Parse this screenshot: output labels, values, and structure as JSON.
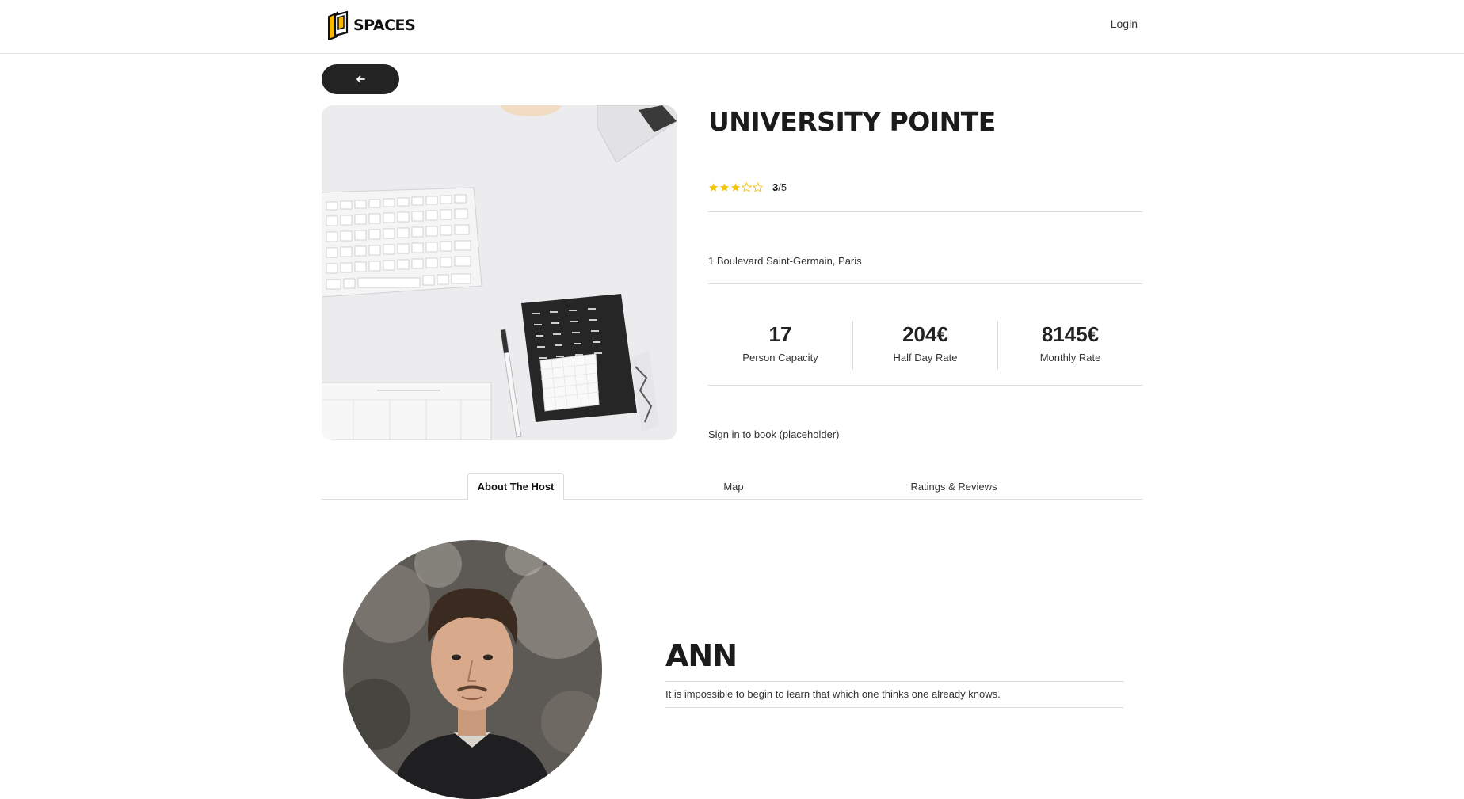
{
  "header": {
    "logo_text": "SPACES",
    "login_label": "Login"
  },
  "back_button": {
    "icon": "arrow-left-icon"
  },
  "listing": {
    "title": "UNIVERSITY POINTE",
    "rating_value": "3",
    "rating_max": "/5",
    "rating_score": 3,
    "address": "1 Boulevard Saint-Germain, Paris",
    "stats": [
      {
        "value": "17",
        "label": "Person Capacity"
      },
      {
        "value": "204€",
        "label": "Half Day Rate"
      },
      {
        "value": "8145€",
        "label": "Monthly Rate"
      }
    ],
    "booking_note": "Sign in to book (placeholder)"
  },
  "tabs": [
    {
      "label": "About The Host",
      "active": true
    },
    {
      "label": "Map",
      "active": false
    },
    {
      "label": "Ratings & Reviews",
      "active": false
    }
  ],
  "host": {
    "name": "ANN",
    "quote": "It is impossible to begin to learn that which one thinks one already knows."
  },
  "colors": {
    "accent_star": "#f5c518",
    "logo_yellow": "#f5b800",
    "button_dark": "#242424"
  }
}
